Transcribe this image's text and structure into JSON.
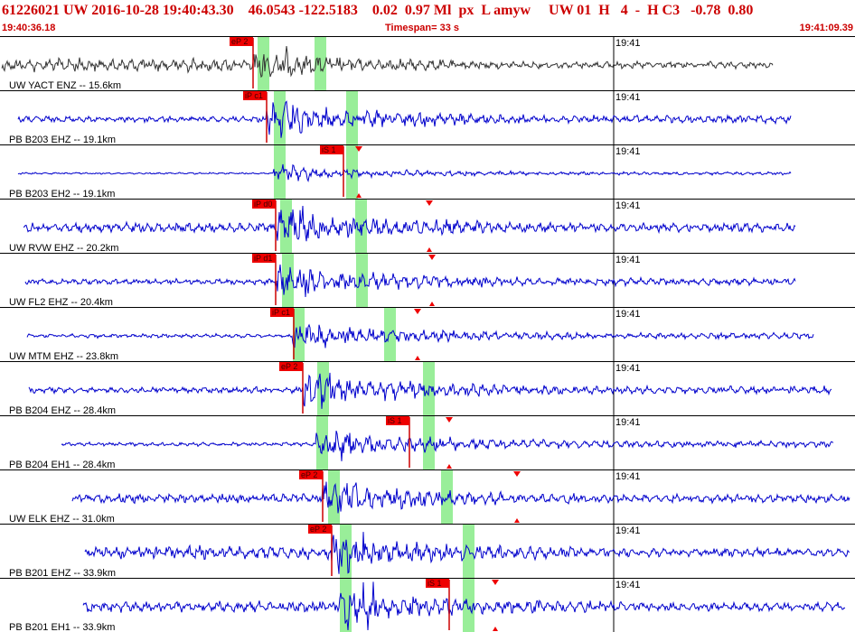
{
  "header": {
    "title": "61226021 UW 2016-10-28 19:40:43.30    46.0543 -122.5183    0.02  0.97 Ml  px  L amyw     UW 01  H   4  -  H C3   -0.78  0.80",
    "start_time": "19:40:36.18",
    "timespan": "Timespan=  33 s",
    "end_time": "19:41:09.39"
  },
  "colors": {
    "trace_first": "#333333",
    "trace": "#0000cc",
    "pick": "#cc0000",
    "window": "#99ee99",
    "label": "#000000"
  },
  "traces": [
    {
      "label": "UW YACT ENZ -- 15.6km",
      "time": "19:41",
      "pick": "eP 2",
      "window_phase": "P"
    },
    {
      "label": "PB B203 EHZ -- 19.1km",
      "time": "19:41",
      "pick": "iP c1",
      "window_phase": "P"
    },
    {
      "label": "PB B203 EH2 -- 19.1km",
      "time": "19:41",
      "pick": "iS 1",
      "window_phase": "S"
    },
    {
      "label": "UW RVW EHZ -- 20.2km",
      "time": "19:41",
      "pick": "iP d0",
      "window_phase": "P"
    },
    {
      "label": "UW FL2 EHZ -- 20.4km",
      "time": "19:41",
      "pick": "iP d1",
      "window_phase": "P"
    },
    {
      "label": "UW MTM EHZ -- 23.8km",
      "time": "19:41",
      "pick": "iP c1",
      "window_phase": "P"
    },
    {
      "label": "PB B204 EHZ -- 28.4km",
      "time": "19:41",
      "pick": "eP 2",
      "window_phase": "P"
    },
    {
      "label": "PB B204 EH1 -- 28.4km",
      "time": "19:41",
      "pick": "iS 1",
      "window_phase": "S"
    },
    {
      "label": "UW ELK EHZ -- 31.0km",
      "time": "19:41",
      "pick": "eP 2",
      "window_phase": "P"
    },
    {
      "label": "PB B201 EHZ -- 33.9km",
      "time": "19:41",
      "pick": "eP 2",
      "window_phase": "P"
    },
    {
      "label": "PB B201 EH1 -- 33.9km",
      "time": "19:41",
      "pick": "iS 1",
      "window_phase": "S"
    }
  ]
}
